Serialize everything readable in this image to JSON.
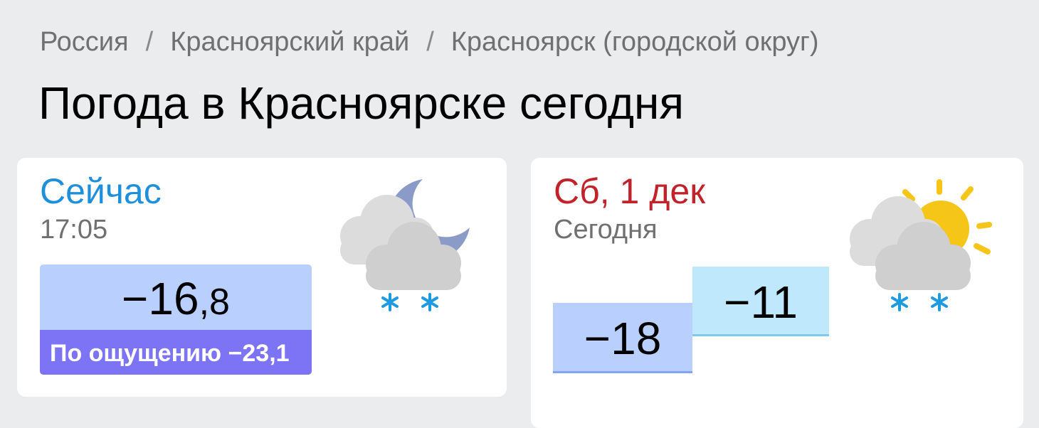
{
  "breadcrumb": {
    "items": [
      "Россия",
      "Красноярский край",
      "Красноярск (городской округ)"
    ],
    "separator": "/"
  },
  "page_title": "Погода в Красноярске сегодня",
  "now": {
    "label": "Сейчас",
    "time": "17:05",
    "temp_int": "−16",
    "temp_frac": ",8",
    "feels_like": "По ощущению −23,1",
    "icon": "cloudy-night-light-snow-icon"
  },
  "today": {
    "label": "Сб, 1 дек",
    "sublabel": "Сегодня",
    "temp_min": "−18",
    "temp_max": "−11",
    "icon": "partly-cloudy-day-light-snow-icon"
  },
  "colors": {
    "now_label": "#1e90db",
    "day_label": "#c2232b",
    "feels_bg": "#7d73f5",
    "temp_bg": "#b9cffd",
    "max_bg": "#bfe8fd",
    "sun": "#f5c518",
    "moon": "#8a9bc8",
    "snow": "#1e9be0"
  }
}
